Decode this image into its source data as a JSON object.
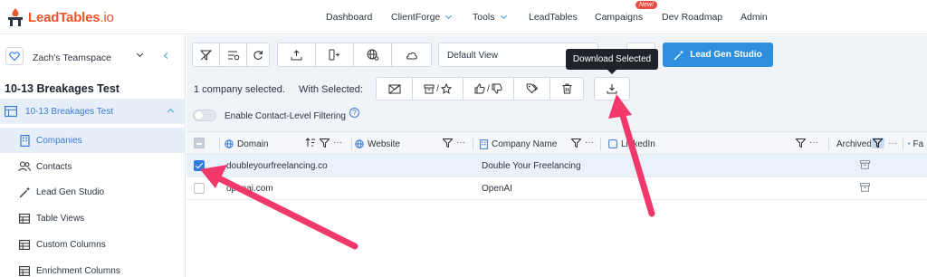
{
  "brand": {
    "name": "LeadTables",
    "tld": ".io",
    "color": "#e8562a"
  },
  "nav": {
    "items": [
      {
        "label": "Dashboard",
        "has_dropdown": false
      },
      {
        "label": "ClientForge",
        "has_dropdown": true
      },
      {
        "label": "Tools",
        "has_dropdown": true
      },
      {
        "label": "LeadTables",
        "has_dropdown": false
      },
      {
        "label": "Campaigns",
        "has_dropdown": false,
        "badge": "New!"
      },
      {
        "label": "Dev Roadmap",
        "has_dropdown": false
      },
      {
        "label": "Admin",
        "has_dropdown": false
      }
    ]
  },
  "sidebar": {
    "team": "Zach's Teamspace",
    "title": "10-13 Breakages Test",
    "database": "10-13 Breakages Test",
    "items": [
      {
        "label": "Companies",
        "icon": "building-icon",
        "active": true
      },
      {
        "label": "Contacts",
        "icon": "users-icon"
      },
      {
        "label": "Lead Gen Studio",
        "icon": "magic-wand-icon"
      },
      {
        "label": "Table Views",
        "icon": "table-icon"
      },
      {
        "label": "Custom Columns",
        "icon": "table-icon"
      },
      {
        "label": "Enrichment Columns",
        "icon": "table-icon"
      }
    ]
  },
  "toolbar": {
    "view_value": "Default View",
    "lead_gen_label": "Lead Gen Studio",
    "lead_gen_color": "#2e8fe0",
    "tooltip": "Download Selected"
  },
  "selection": {
    "count_text": "1 company selected.",
    "with_selected": "With Selected:"
  },
  "filtering": {
    "label": "Enable Contact-Level Filtering",
    "help": "?"
  },
  "table": {
    "columns": [
      {
        "label": "Domain"
      },
      {
        "label": "Website"
      },
      {
        "label": "Company Name"
      },
      {
        "label": "LinkedIn"
      },
      {
        "label": "Archived"
      },
      {
        "label": "Fa"
      }
    ],
    "rows": [
      {
        "domain": "doubleyourfreelancing.co",
        "company": "Double Your Freelancing",
        "selected": true
      },
      {
        "domain": "openai.com",
        "company": "OpenAI",
        "selected": false
      }
    ]
  },
  "annotation_color": "#f2386b"
}
